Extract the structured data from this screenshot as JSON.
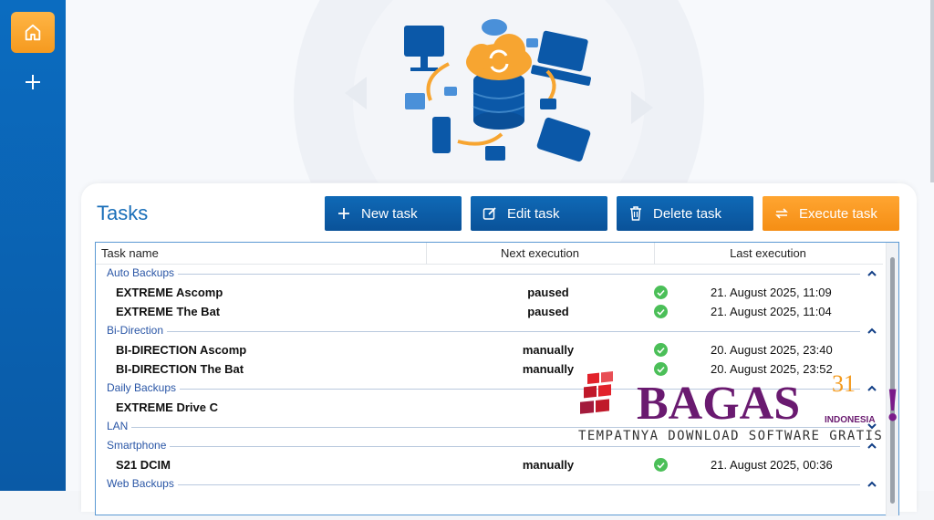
{
  "sidebar": {
    "items": [
      {
        "icon": "home-icon"
      },
      {
        "icon": "plus-icon"
      }
    ]
  },
  "tasks_section": {
    "title": "Tasks",
    "buttons": [
      {
        "label": "New task",
        "icon": "plus-icon",
        "style": "blue"
      },
      {
        "label": "Edit task",
        "icon": "edit-icon",
        "style": "blue"
      },
      {
        "label": "Delete task",
        "icon": "trash-icon",
        "style": "blue"
      },
      {
        "label": "Execute task",
        "icon": "refresh-icon",
        "style": "orange"
      }
    ]
  },
  "table": {
    "columns": [
      "Task name",
      "Next execution",
      "Last execution"
    ],
    "groups": [
      {
        "name": "Auto Backups",
        "rows": [
          {
            "name": "EXTREME Ascomp",
            "next": "paused",
            "last": "21. August 2025, 11:09"
          },
          {
            "name": "EXTREME The Bat",
            "next": "paused",
            "last": "21. August 2025, 11:04"
          }
        ]
      },
      {
        "name": "Bi-Direction",
        "rows": [
          {
            "name": "BI-DIRECTION Ascomp",
            "next": "manually",
            "last": "20. August 2025, 23:40"
          },
          {
            "name": "BI-DIRECTION The Bat",
            "next": "manually",
            "last": "20. August 2025, 23:52"
          }
        ]
      },
      {
        "name": "Daily Backups",
        "rows": [
          {
            "name": "EXTREME Drive C",
            "next": "",
            "last": ""
          }
        ]
      },
      {
        "name": "LAN",
        "rows": []
      },
      {
        "name": "Smartphone",
        "rows": [
          {
            "name": "S21 DCIM",
            "next": "manually",
            "last": "21. August 2025, 00:36"
          }
        ]
      },
      {
        "name": "Web Backups",
        "rows": []
      }
    ]
  },
  "watermark": {
    "brand": "BAGAS",
    "number": "31",
    "country": "INDONESIA",
    "tagline": "TEMPATNYA DOWNLOAD SOFTWARE GRATIS"
  },
  "colors": {
    "sidebar": "#0a5ea9",
    "accent_orange": "#f7941d",
    "button_blue": "#0d5ea8",
    "title_blue": "#1a6fb9"
  }
}
